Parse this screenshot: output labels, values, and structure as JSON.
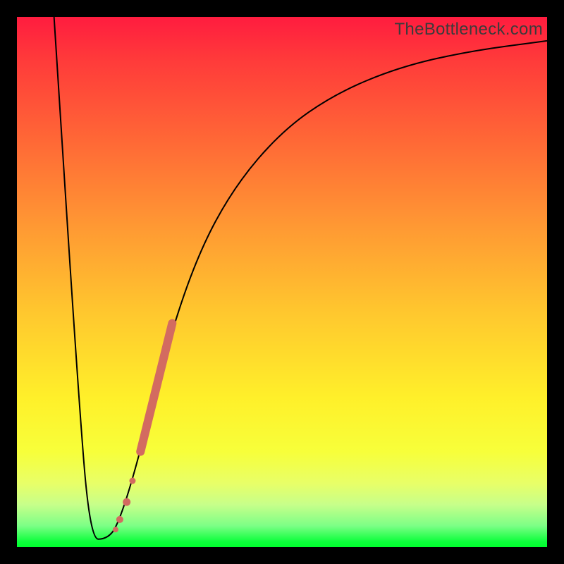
{
  "watermark": "TheBottleneck.com",
  "colors": {
    "frame": "#000000",
    "curve": "#000000",
    "marker": "#d36b60",
    "gradient_top": "#ff1c3f",
    "gradient_bottom": "#00ff2e"
  },
  "chart_data": {
    "type": "line",
    "title": "",
    "xlabel": "",
    "ylabel": "",
    "xlim": [
      0,
      100
    ],
    "ylim": [
      0,
      100
    ],
    "grid": false,
    "curve_black": [
      {
        "x": 7.0,
        "y": 100.0
      },
      {
        "x": 11.5,
        "y": 30.0
      },
      {
        "x": 13.8,
        "y": 1.5
      },
      {
        "x": 16.9,
        "y": 1.5
      },
      {
        "x": 19.0,
        "y": 4.0
      },
      {
        "x": 22.5,
        "y": 15.0
      },
      {
        "x": 28.0,
        "y": 37.0
      },
      {
        "x": 34.0,
        "y": 55.0
      },
      {
        "x": 41.0,
        "y": 68.0
      },
      {
        "x": 50.0,
        "y": 78.5
      },
      {
        "x": 60.0,
        "y": 85.5
      },
      {
        "x": 72.0,
        "y": 90.5
      },
      {
        "x": 85.0,
        "y": 93.5
      },
      {
        "x": 100.0,
        "y": 95.5
      }
    ],
    "markers_thick_segment": [
      {
        "x": 23.3,
        "y": 18.0
      },
      {
        "x": 29.3,
        "y": 42.2
      }
    ],
    "markers_dots": [
      {
        "x": 21.8,
        "y": 12.5,
        "r": 4.5
      },
      {
        "x": 20.7,
        "y": 8.5,
        "r": 5.5
      },
      {
        "x": 19.4,
        "y": 5.2,
        "r": 5.0
      },
      {
        "x": 18.6,
        "y": 3.3,
        "r": 4.0
      }
    ]
  }
}
